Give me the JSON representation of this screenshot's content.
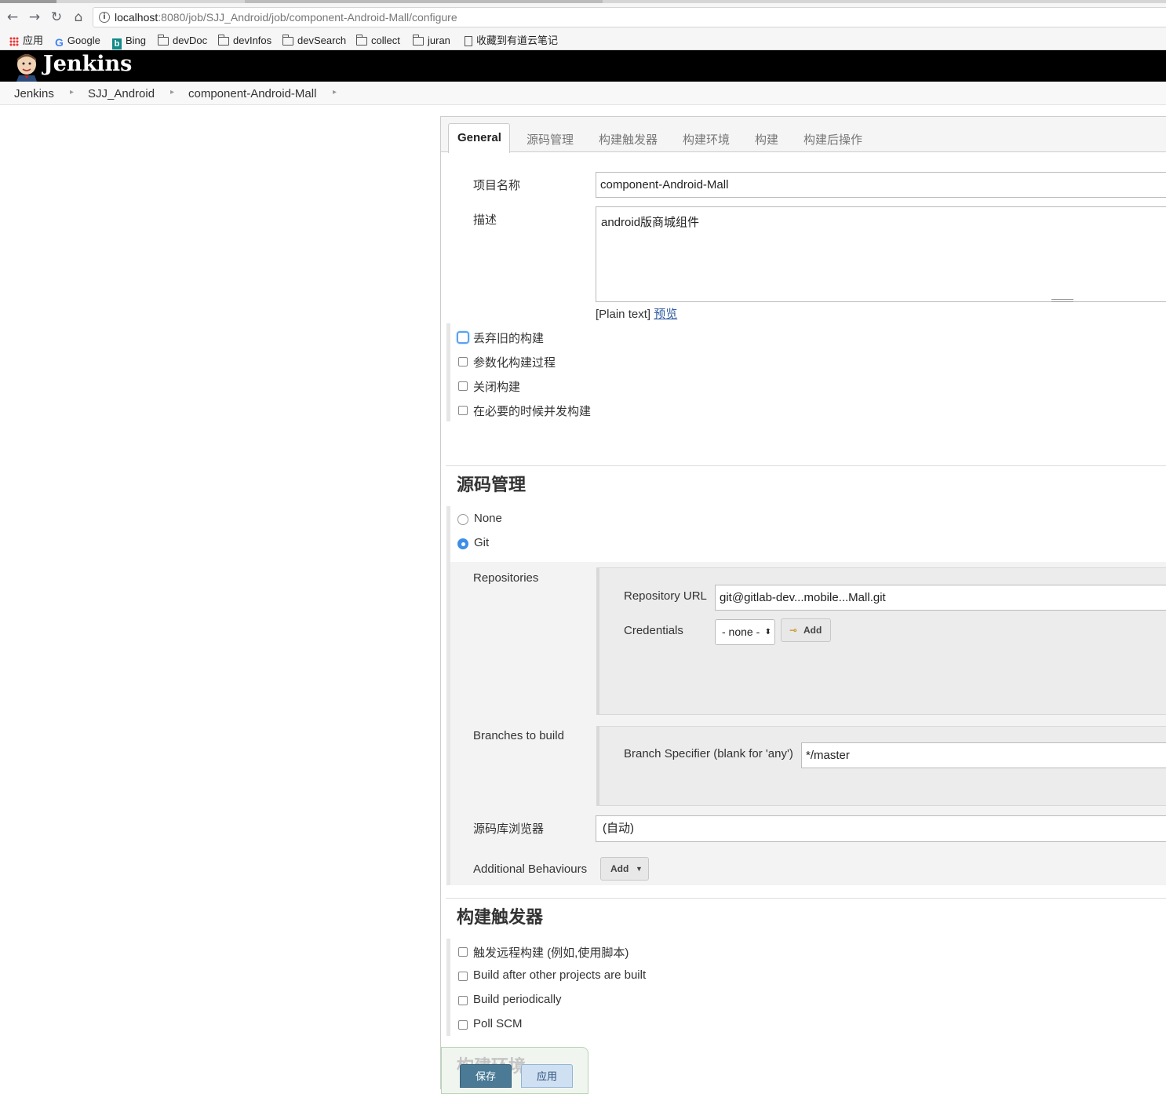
{
  "browser": {
    "url_host": "localhost",
    "url_rest": ":8080/job/SJJ_Android/job/component-Android-Mall/configure",
    "bookmarks": [
      "应用",
      "Google",
      "Bing",
      "devDoc",
      "devInfos",
      "devSearch",
      "collect",
      "juran",
      "收藏到有道云笔记"
    ]
  },
  "header": {
    "title": "Jenkins"
  },
  "breadcrumbs": [
    "Jenkins",
    "SJJ_Android",
    "component-Android-Mall"
  ],
  "tabs": [
    "General",
    "源码管理",
    "构建触发器",
    "构建环境",
    "构建",
    "构建后操作"
  ],
  "general": {
    "project_name_label": "项目名称",
    "project_name": "component-Android-Mall",
    "description_label": "描述",
    "description": "android版商城组件",
    "plain_text": "[Plain text]",
    "preview_link": "预览",
    "options": [
      "丢弃旧的构建",
      "参数化构建过程",
      "关闭构建",
      "在必要的时候并发构建"
    ]
  },
  "scm": {
    "heading": "源码管理",
    "radios": [
      "None",
      "Git"
    ],
    "selected": "Git",
    "repositories_label": "Repositories",
    "repo_url_label": "Repository URL",
    "repo_url": "git@gitlab-dev...mobile...Mall.git",
    "credentials_label": "Credentials",
    "credentials_value": "- none -",
    "add_label": "Add",
    "branches_label": "Branches to build",
    "branch_spec_label": "Branch Specifier (blank for 'any')",
    "branch_spec": "*/master",
    "browser_label": "源码库浏览器",
    "browser_value": "(自动)",
    "behaviours_label": "Additional Behaviours",
    "behaviours_add": "Add"
  },
  "triggers": {
    "heading": "构建触发器",
    "options": [
      "触发远程构建 (例如,使用脚本)",
      "Build after other projects are built",
      "Build periodically",
      "Poll SCM"
    ]
  },
  "build_env": {
    "heading": "构建环境"
  },
  "buttons": {
    "save": "保存",
    "apply": "应用"
  },
  "colors": {
    "header_bg": "#000000",
    "accent": "#3d8ee8",
    "save_bg": "#4a7a96",
    "apply_bg": "#cfe0f2"
  }
}
